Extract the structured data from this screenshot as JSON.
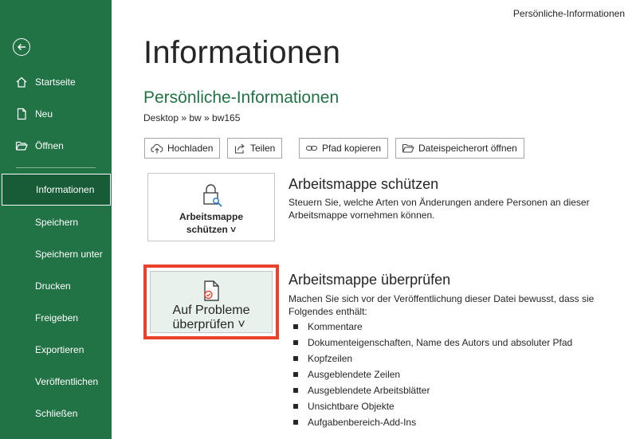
{
  "window": {
    "title": "Persönliche-Informationen"
  },
  "sidebar": {
    "back_icon": "arrow-left-circle-icon",
    "items": [
      {
        "label": "Startseite",
        "icon": "home-icon"
      },
      {
        "label": "Neu",
        "icon": "new-document-icon"
      },
      {
        "label": "Öffnen",
        "icon": "open-folder-icon"
      },
      {
        "label": "Informationen",
        "active": true
      },
      {
        "label": "Speichern"
      },
      {
        "label": "Speichern unter"
      },
      {
        "label": "Drucken"
      },
      {
        "label": "Freigeben"
      },
      {
        "label": "Exportieren"
      },
      {
        "label": "Veröffentlichen"
      },
      {
        "label": "Schließen"
      }
    ]
  },
  "main": {
    "title": "Informationen",
    "doc_name": "Persönliche-Informationen",
    "breadcrumb": "Desktop » bw » bw165",
    "actions": [
      {
        "label": "Hochladen",
        "icon": "cloud-upload-icon"
      },
      {
        "label": "Teilen",
        "icon": "share-icon"
      },
      {
        "label": "Pfad kopieren",
        "icon": "link-icon"
      },
      {
        "label": "Dateispeicherort öffnen",
        "icon": "folder-icon"
      }
    ],
    "protect": {
      "tile_line1": "Arbeitsmappe",
      "tile_line2": "schützen ˅",
      "icon": "lock-key-icon",
      "title": "Arbeitsmappe schützen",
      "desc": "Steuern Sie, welche Arten von Änderungen andere Personen an dieser Arbeitsmappe vornehmen können."
    },
    "inspect": {
      "tile_line1": "Auf Probleme",
      "tile_line2": "überprüfen ˅",
      "icon": "document-check-icon",
      "title": "Arbeitsmappe überprüfen",
      "desc": "Machen Sie sich vor der Veröffentlichung dieser Datei bewusst, dass sie Folgendes enthält:",
      "items": [
        "Kommentare",
        "Dokumenteigenschaften, Name des Autors und absoluter Pfad",
        "Kopfzeilen",
        "Ausgeblendete Zeilen",
        "Ausgeblendete Arbeitsblätter",
        "Unsichtbare Objekte",
        "Aufgabenbereich-Add-Ins"
      ]
    }
  },
  "colors": {
    "accent": "#217346",
    "highlight": "#e8412c"
  }
}
